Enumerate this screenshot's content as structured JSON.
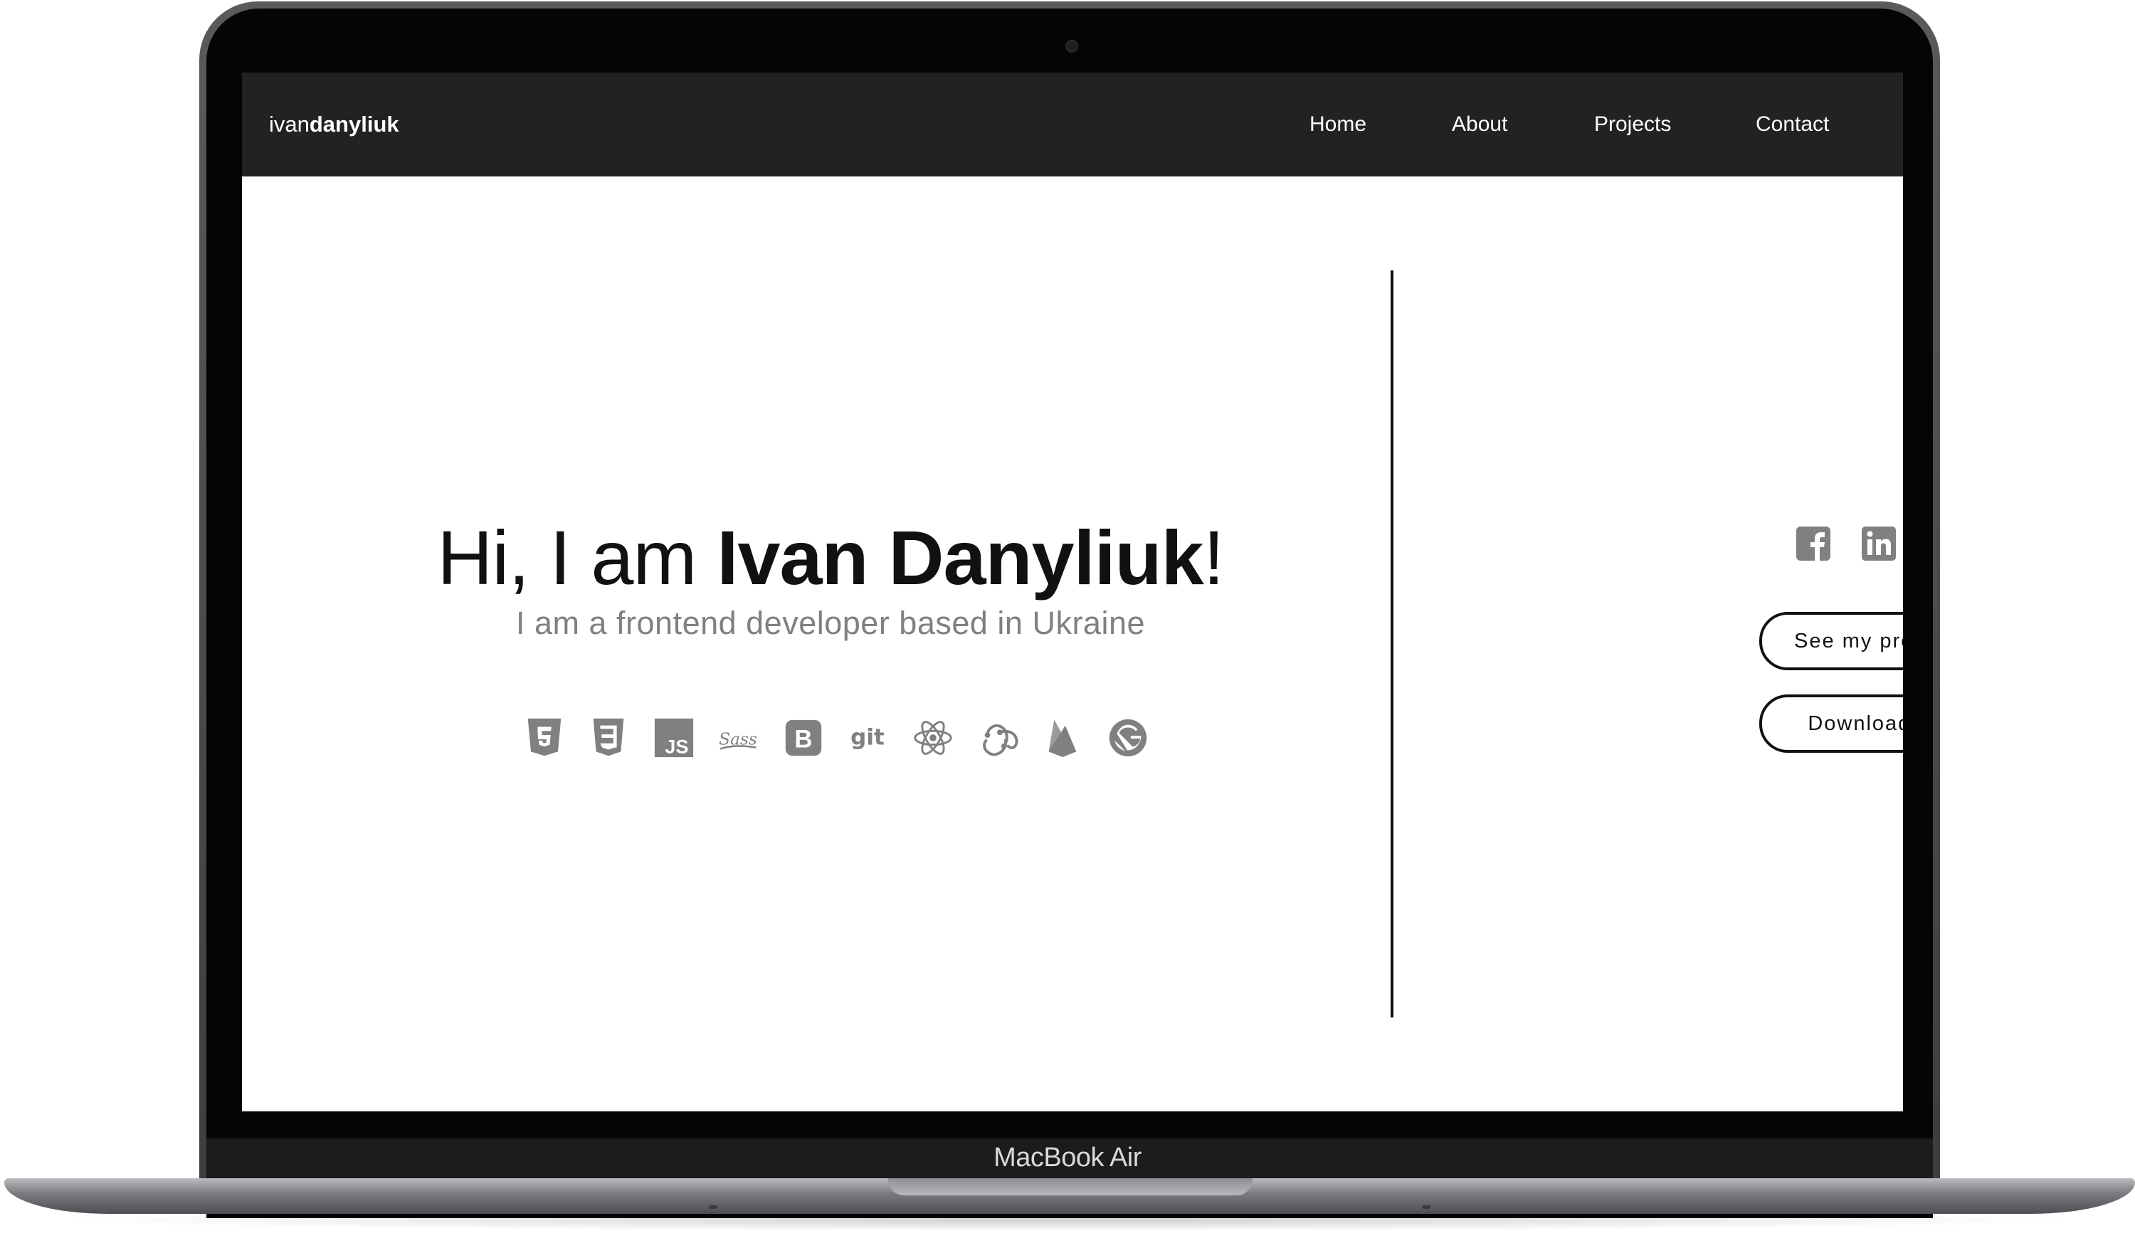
{
  "device": {
    "label": "MacBook Air"
  },
  "nav": {
    "brand_light": "ivan",
    "brand_bold": "danyliuk",
    "links": [
      "Home",
      "About",
      "Projects",
      "Contact"
    ]
  },
  "hero": {
    "greeting": "Hi, I am ",
    "name": "Ivan Danyliuk",
    "exclaim": "!",
    "subtitle": "I am a frontend developer based in Ukraine",
    "tech_icons": [
      "html5-icon",
      "css3-icon",
      "javascript-icon",
      "sass-icon",
      "bootstrap-icon",
      "git-icon",
      "react-icon",
      "redux-icon",
      "firebase-icon",
      "gatsby-icon"
    ],
    "git_text": "git",
    "js_text": "JS",
    "bootstrap_text": "B",
    "sass_text": "Sass"
  },
  "social": {
    "icons": [
      "facebook-icon",
      "linkedin-icon",
      "github-icon"
    ]
  },
  "buttons": {
    "projects": "See my projects",
    "cv": "Download CV"
  },
  "colors": {
    "navbar": "#222222",
    "icon_gray": "#808080",
    "text_dark": "#111111"
  }
}
